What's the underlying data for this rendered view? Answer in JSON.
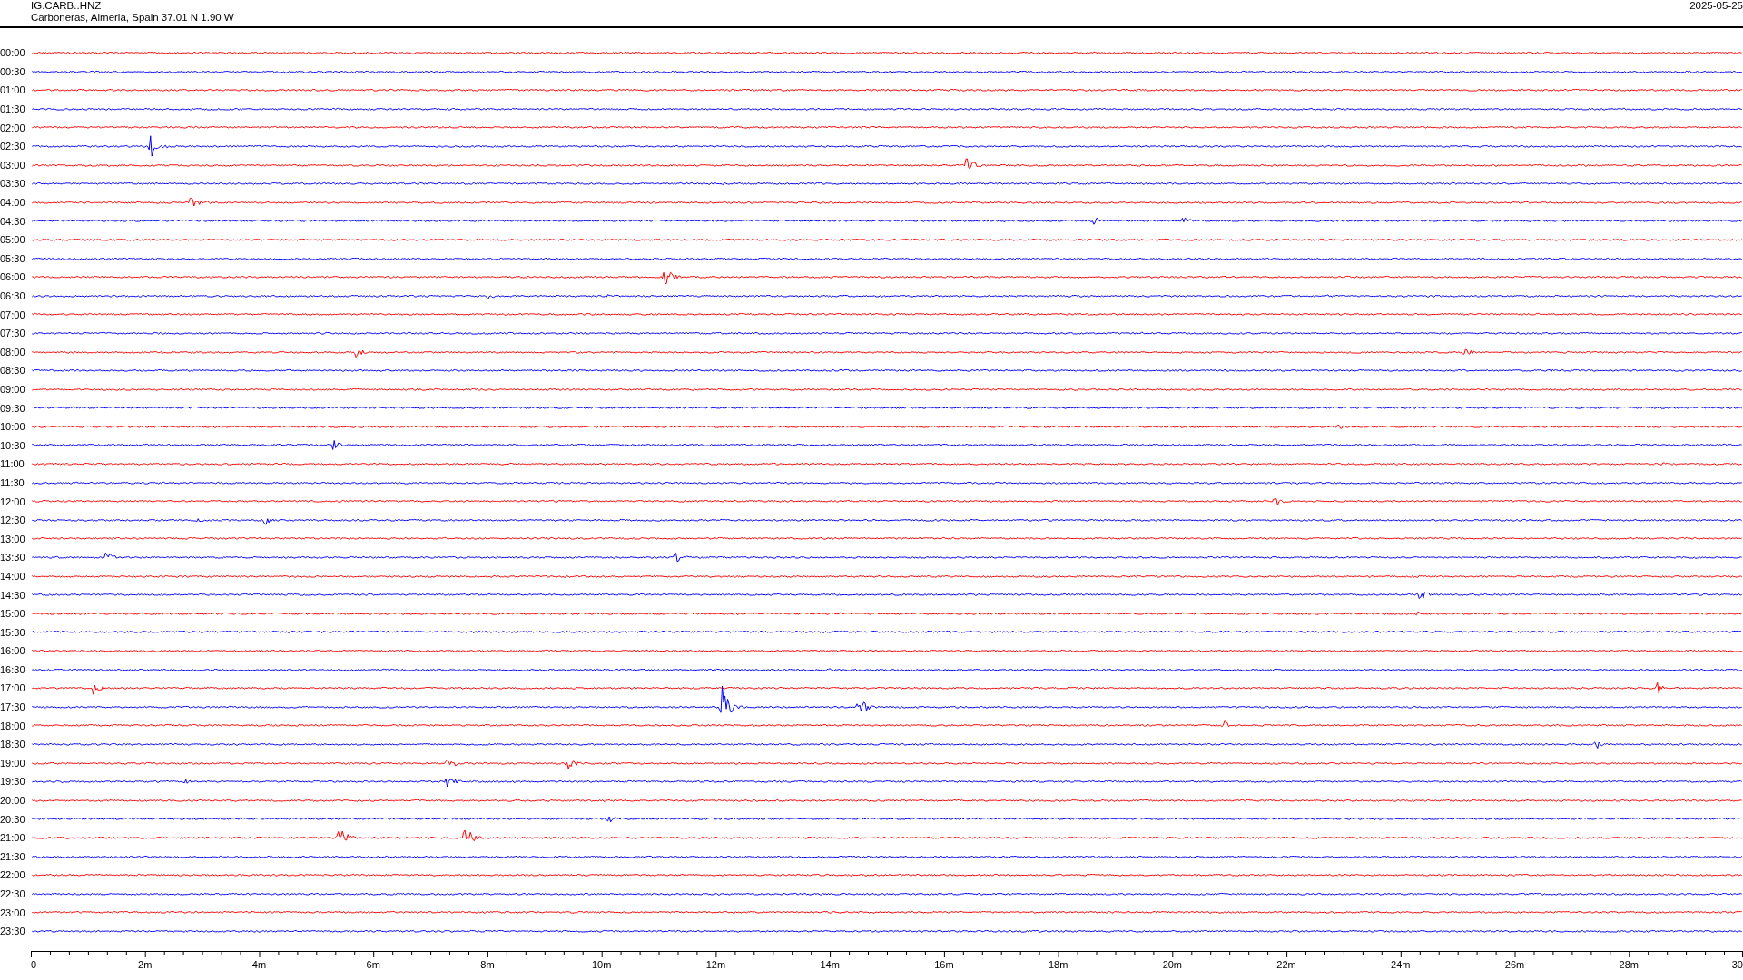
{
  "header": {
    "station": "IG.CARB..HNZ",
    "location": "Carboneras, Almeria, Spain  37.01 N 1.90 W",
    "date": "2025-05-25"
  },
  "rows": [
    {
      "time": "00:00",
      "color": "#ff0000"
    },
    {
      "time": "00:30",
      "color": "#0000ff"
    },
    {
      "time": "01:00",
      "color": "#ff0000"
    },
    {
      "time": "01:30",
      "color": "#0000ff"
    },
    {
      "time": "02:00",
      "color": "#ff0000"
    },
    {
      "time": "02:30",
      "color": "#0000ff"
    },
    {
      "time": "03:00",
      "color": "#ff0000"
    },
    {
      "time": "03:30",
      "color": "#0000ff"
    },
    {
      "time": "04:00",
      "color": "#ff0000"
    },
    {
      "time": "04:30",
      "color": "#0000ff"
    },
    {
      "time": "05:00",
      "color": "#ff0000"
    },
    {
      "time": "05:30",
      "color": "#0000ff"
    },
    {
      "time": "06:00",
      "color": "#ff0000"
    },
    {
      "time": "06:30",
      "color": "#0000ff"
    },
    {
      "time": "07:00",
      "color": "#ff0000"
    },
    {
      "time": "07:30",
      "color": "#0000ff"
    },
    {
      "time": "08:00",
      "color": "#ff0000"
    },
    {
      "time": "08:30",
      "color": "#0000ff"
    },
    {
      "time": "09:00",
      "color": "#ff0000"
    },
    {
      "time": "09:30",
      "color": "#0000ff"
    },
    {
      "time": "10:00",
      "color": "#ff0000"
    },
    {
      "time": "10:30",
      "color": "#0000ff"
    },
    {
      "time": "11:00",
      "color": "#ff0000"
    },
    {
      "time": "11:30",
      "color": "#0000ff"
    },
    {
      "time": "12:00",
      "color": "#ff0000"
    },
    {
      "time": "12:30",
      "color": "#0000ff"
    },
    {
      "time": "13:00",
      "color": "#ff0000"
    },
    {
      "time": "13:30",
      "color": "#0000ff"
    },
    {
      "time": "14:00",
      "color": "#ff0000"
    },
    {
      "time": "14:30",
      "color": "#0000ff"
    },
    {
      "time": "15:00",
      "color": "#ff0000"
    },
    {
      "time": "15:30",
      "color": "#0000ff"
    },
    {
      "time": "16:00",
      "color": "#ff0000"
    },
    {
      "time": "16:30",
      "color": "#0000ff"
    },
    {
      "time": "17:00",
      "color": "#ff0000"
    },
    {
      "time": "17:30",
      "color": "#0000ff"
    },
    {
      "time": "18:00",
      "color": "#ff0000"
    },
    {
      "time": "18:30",
      "color": "#0000ff"
    },
    {
      "time": "19:00",
      "color": "#ff0000"
    },
    {
      "time": "19:30",
      "color": "#0000ff"
    },
    {
      "time": "20:00",
      "color": "#ff0000"
    },
    {
      "time": "20:30",
      "color": "#0000ff"
    },
    {
      "time": "21:00",
      "color": "#ff0000"
    },
    {
      "time": "21:30",
      "color": "#0000ff"
    },
    {
      "time": "22:00",
      "color": "#ff0000"
    },
    {
      "time": "22:30",
      "color": "#0000ff"
    },
    {
      "time": "23:00",
      "color": "#ff0000"
    },
    {
      "time": "23:30",
      "color": "#0000ff"
    }
  ],
  "axis_labels": [
    "0",
    "2m",
    "4m",
    "6m",
    "8m",
    "10m",
    "12m",
    "14m",
    "16m",
    "18m",
    "20m",
    "22m",
    "24m",
    "26m",
    "28m",
    "30"
  ]
}
